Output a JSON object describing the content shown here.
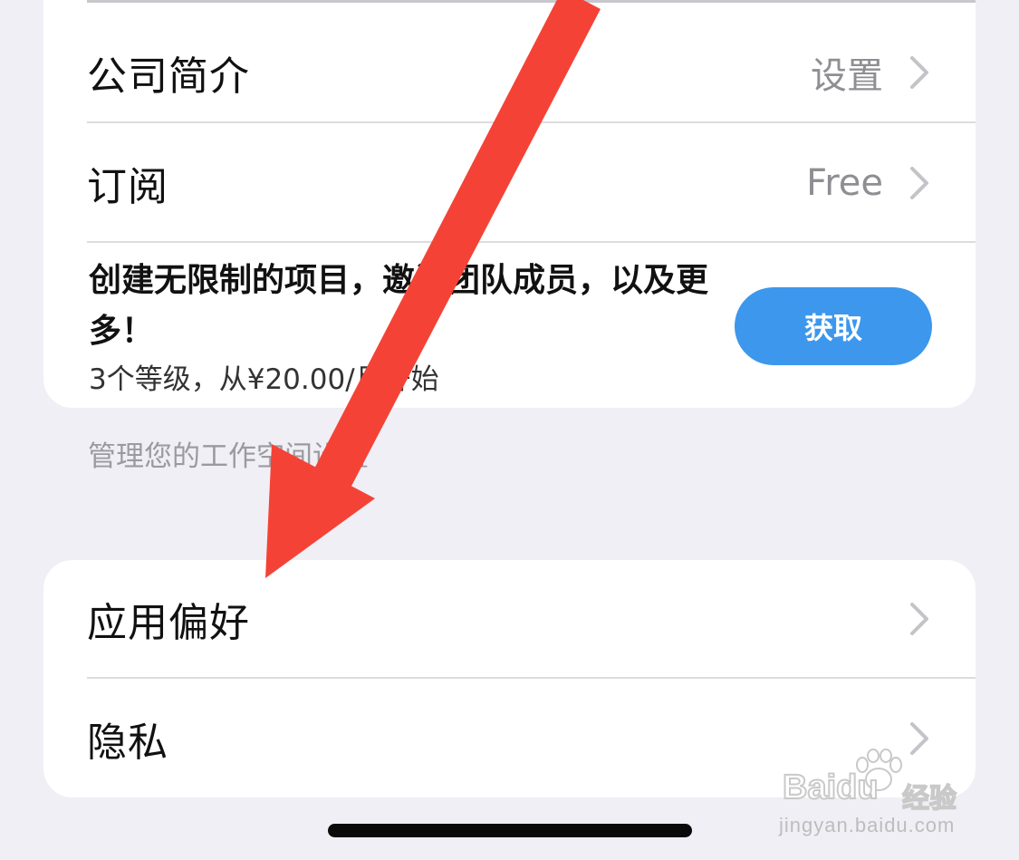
{
  "settings_group_1": {
    "rows": [
      {
        "label": "公司简介",
        "value": "设置"
      },
      {
        "label": "订阅",
        "value": "Free"
      }
    ],
    "promo": {
      "title": "创建无限制的项目，邀请团队成员，以及更多！",
      "subtitle": "3个等级，从¥20.00/月开始",
      "button_label": "获取"
    },
    "footer": "管理您的工作空间设置"
  },
  "settings_group_2": {
    "rows": [
      {
        "label": "应用偏好"
      },
      {
        "label": "隐私"
      }
    ]
  },
  "icons": {
    "chevron": "chevron-right-icon",
    "annotation": "red-arrow-icon"
  },
  "colors": {
    "accent": "#3d97ec",
    "annotation_arrow": "#f44336",
    "background": "#f0eff5"
  },
  "watermark": {
    "brand": "Baidu",
    "cn": "经验",
    "url": "jingyan.baidu.com"
  }
}
